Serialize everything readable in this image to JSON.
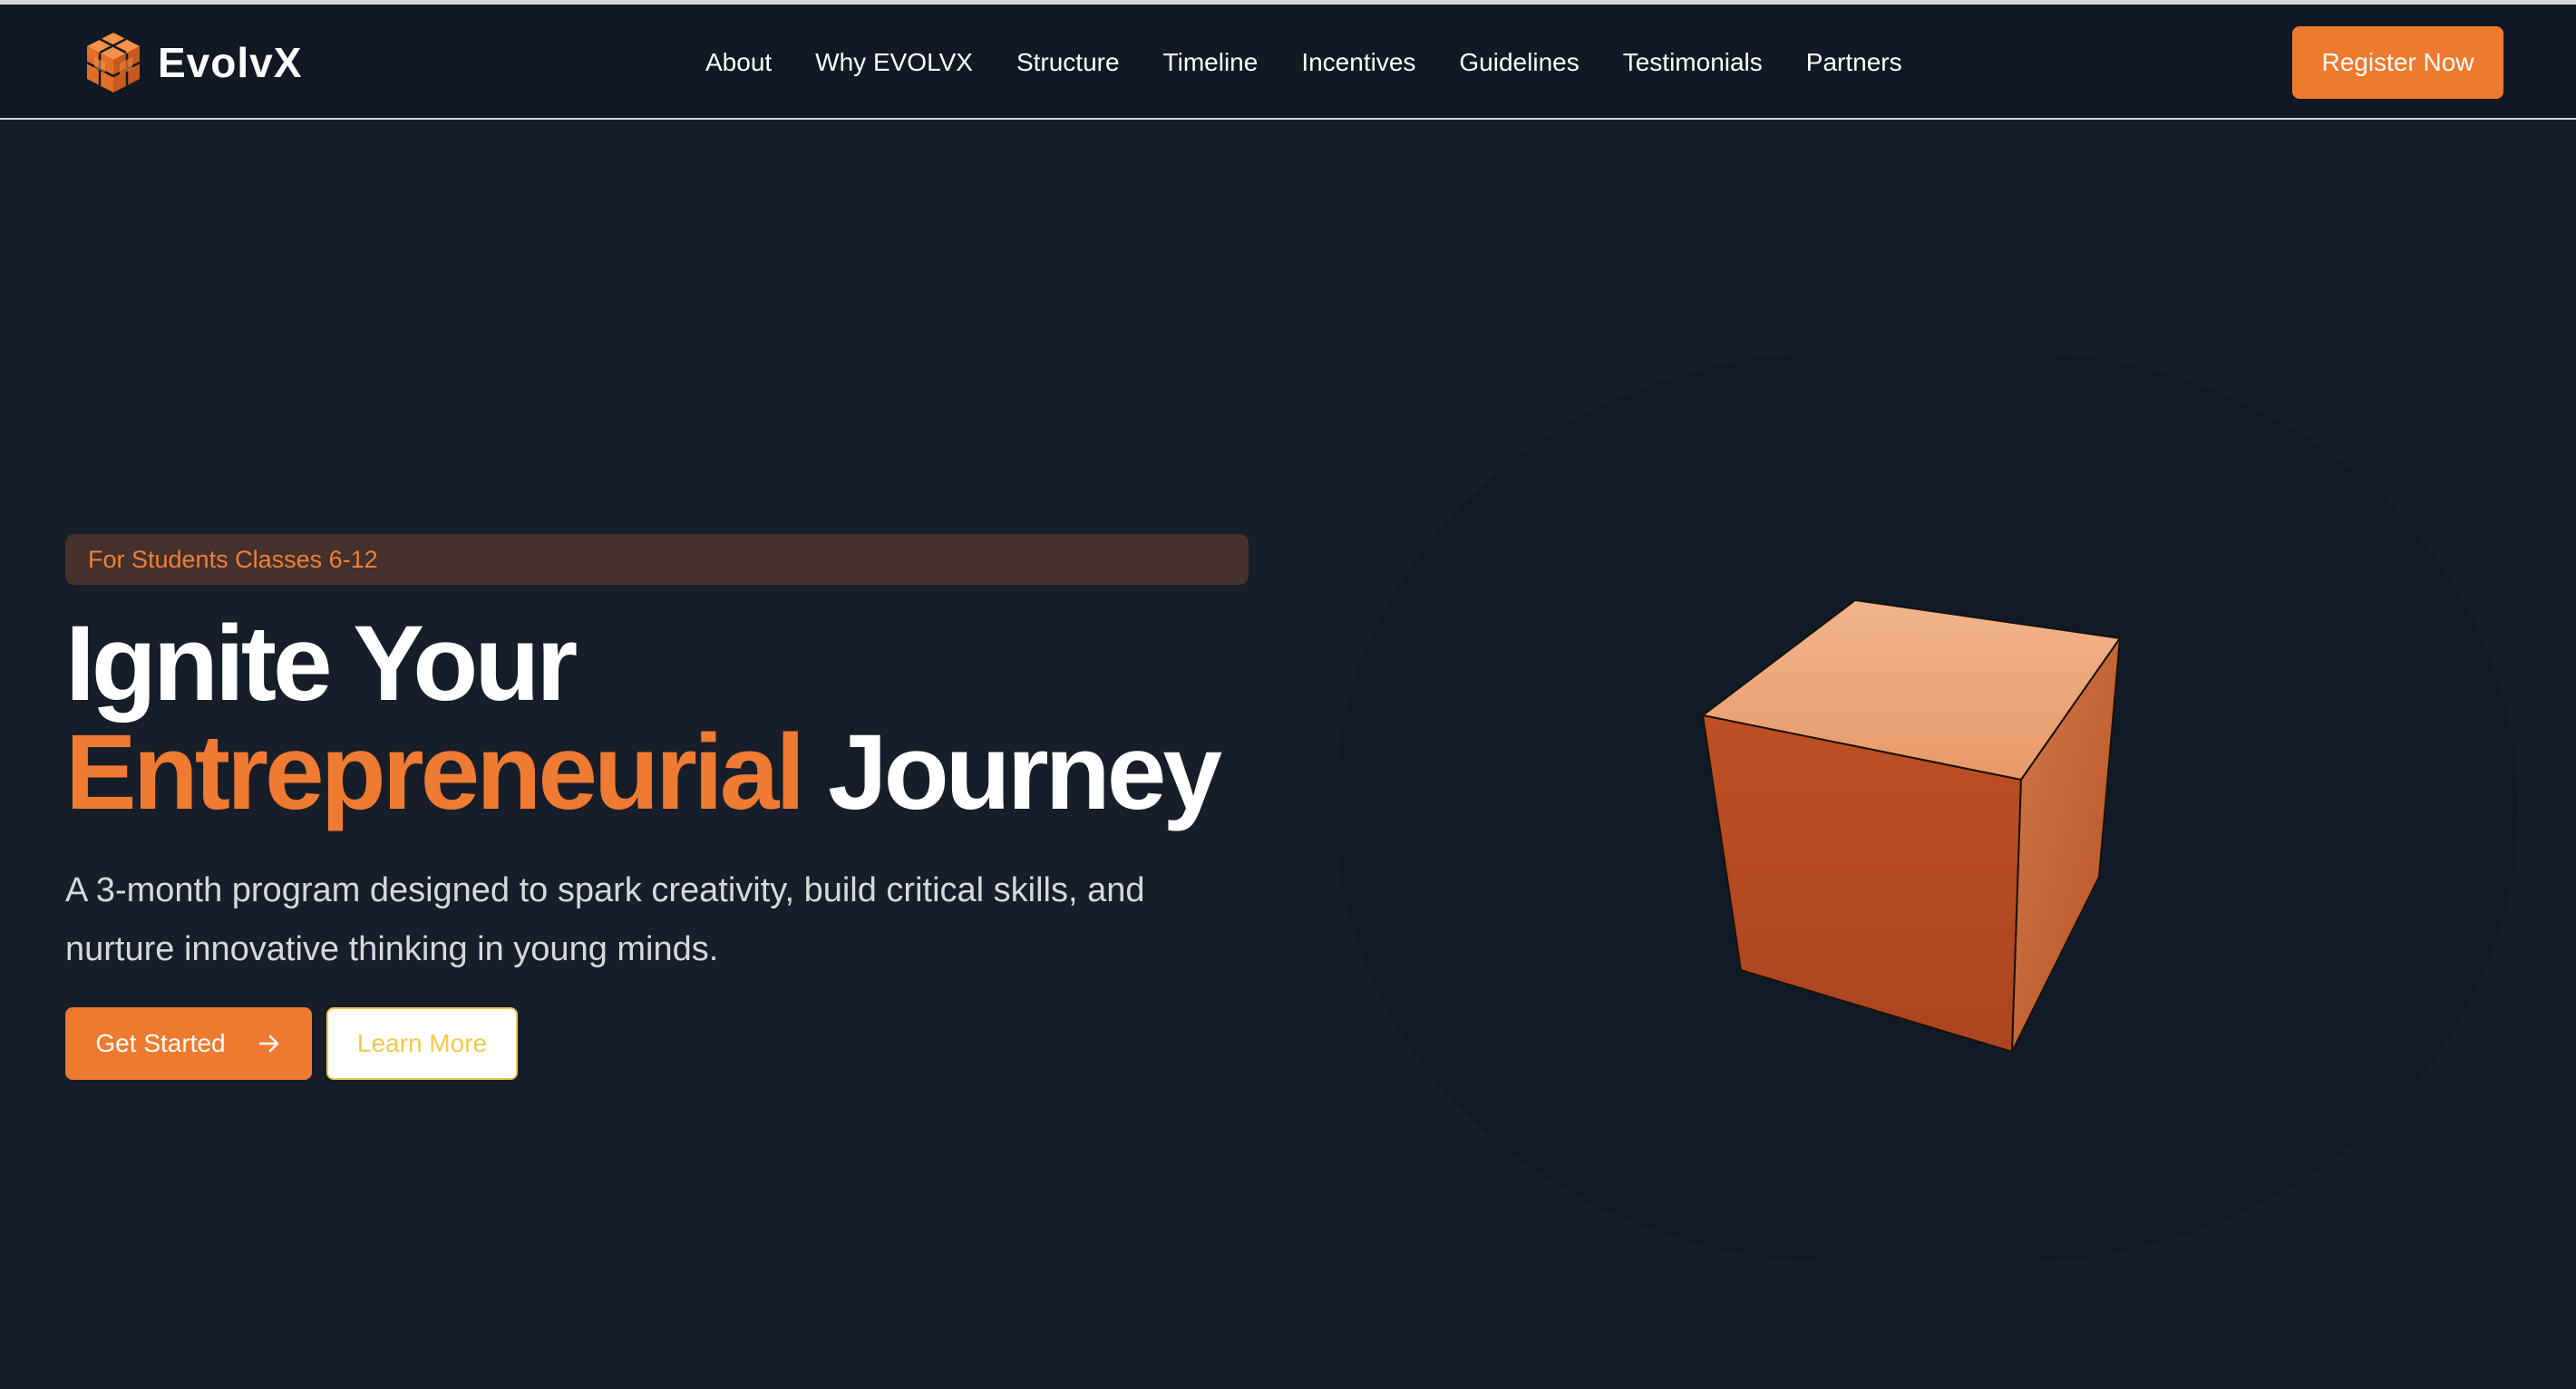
{
  "brand": {
    "name": "EvolvX",
    "logo_icon": "cube-logo-icon",
    "accent_color": "#ed7a2f"
  },
  "nav": {
    "items": [
      {
        "label": "About"
      },
      {
        "label": "Why EVOLVX"
      },
      {
        "label": "Structure"
      },
      {
        "label": "Timeline"
      },
      {
        "label": "Incentives"
      },
      {
        "label": "Guidelines"
      },
      {
        "label": "Testimonials"
      },
      {
        "label": "Partners"
      }
    ],
    "register_label": "Register Now"
  },
  "hero": {
    "badge": "For Students Classes 6-12",
    "headline_line1": "Ignite Your",
    "headline_accent": "Entrepreneurial",
    "headline_end": "Journey",
    "subtitle": "A 3-month program designed to spark creativity, build critical skills, and nurture innovative thinking in young minds.",
    "primary_cta": "Get Started",
    "primary_cta_icon": "arrow-right-icon",
    "secondary_cta": "Learn More",
    "illustration_icon": "3d-cube-icon"
  }
}
